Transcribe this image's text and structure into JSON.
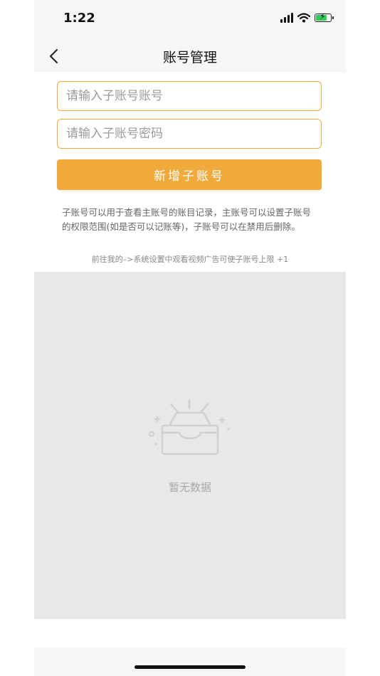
{
  "status_bar": {
    "time": "1:22"
  },
  "nav": {
    "title": "账号管理"
  },
  "form": {
    "account_placeholder": "请输入子账号账号",
    "password_placeholder": "请输入子账号密码",
    "add_button_label": "新增子账号"
  },
  "info": {
    "description": "子账号可以用于查看主账号的账目记录，主账号可以设置子账号的权限范围(如是否可以记账等)，子账号可以在禁用后删除。",
    "hint": "前往我的–>系统设置中观看视频广告可使子账号上限 +1"
  },
  "list": {
    "empty_text": "暂无数据"
  },
  "colors": {
    "accent": "#f0a93b",
    "input_border": "#efaa3a",
    "list_bg": "#e8e8e8"
  }
}
